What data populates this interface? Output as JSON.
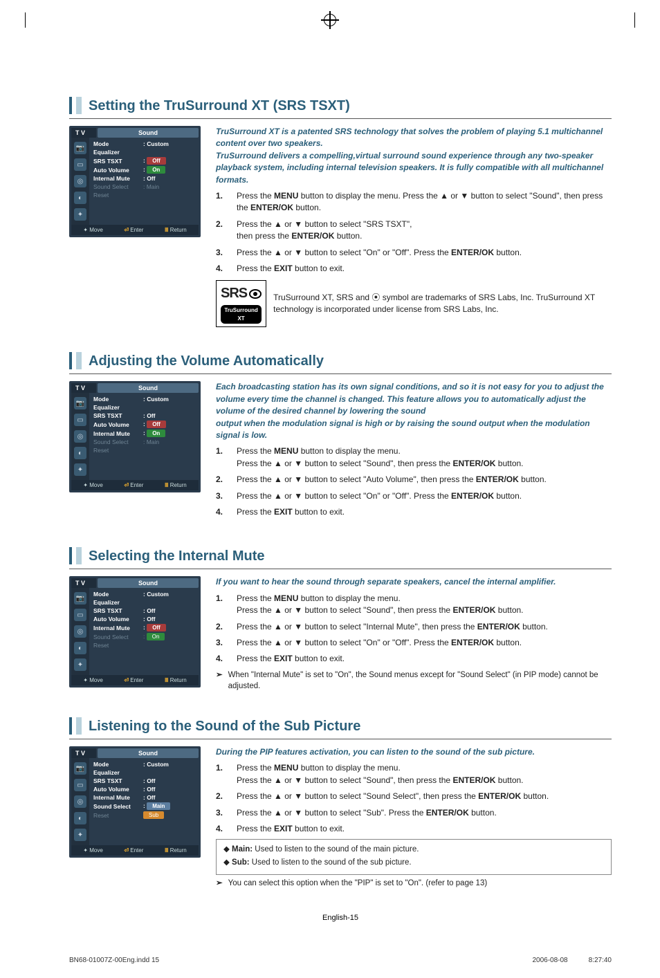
{
  "osd_common": {
    "tv": "T V",
    "title": "Sound",
    "nav": {
      "move": "Move",
      "enter": "Enter",
      "return": "Return"
    }
  },
  "sections": [
    {
      "heading": "Setting the TruSurround XT (SRS TSXT)",
      "intro": "TruSurround XT is a patented SRS technology that solves the problem of playing 5.1 multichannel content over two speakers.\nTruSurround delivers a compelling,virtual surround sound experience through any two-speaker playback system, including internal television speakers. It is fully compatible with all multichannel formats.",
      "steps": [
        "Press the <b>MENU</b> button to display the menu. Press the ▲ or ▼ button to select \"Sound\", then press the <b>ENTER/OK</b> button.",
        "Press the ▲ or ▼ button to select \"SRS TSXT\",<br>then press the <b>ENTER/OK</b> button.",
        "Press the ▲ or ▼ button to select \"On\" or \"Off\". Press the <b>ENTER/OK</b> button.",
        "Press the <b>EXIT</b> button to exit."
      ],
      "srs_note": "TruSurround XT, SRS and ⦿ symbol are trademarks of SRS Labs, Inc. TruSurround XT technology is incorporated under license from SRS Labs, Inc.",
      "srs_logo": {
        "brand": "SRS",
        "tag": "TruSurround XT"
      },
      "osd_rows": [
        {
          "lbl": "Mode",
          "val": ": Custom",
          "cls": "hl"
        },
        {
          "lbl": "Equalizer",
          "val": "",
          "cls": "hl"
        },
        {
          "lbl": "SRS TSXT",
          "val": ":",
          "cls": "hl",
          "pill": "off",
          "pill_txt": "Off"
        },
        {
          "lbl": "Auto Volume",
          "val": ":",
          "cls": "hl",
          "pill": "on",
          "pill_txt": "On"
        },
        {
          "lbl": "Internal Mute",
          "val": ": Off",
          "cls": "hl"
        },
        {
          "lbl": "Sound Select",
          "val": ": Main",
          "cls": "dim"
        },
        {
          "lbl": "Reset",
          "val": "",
          "cls": "dim"
        }
      ]
    },
    {
      "heading": "Adjusting the Volume Automatically",
      "intro": "Each broadcasting station has its own signal conditions, and so it is not easy for you to adjust the volume every time the channel is changed. This feature allows you to automatically adjust the volume of the desired channel by lowering the sound\noutput when the modulation signal is high or by raising the sound output when the modulation signal is low.",
      "steps": [
        "Press the <b>MENU</b> button to display the menu.<br>Press the ▲ or ▼ button to select \"Sound\", then press the <b>ENTER/OK</b> button.",
        "Press the ▲ or ▼ button to select \"Auto Volume\", then press the <b>ENTER/OK</b> button.",
        "Press the ▲ or ▼ button to select \"On\" or \"Off\". Press the <b>ENTER/OK</b> button.",
        "Press the <b>EXIT</b> button to exit."
      ],
      "osd_rows": [
        {
          "lbl": "Mode",
          "val": ": Custom",
          "cls": "hl"
        },
        {
          "lbl": "Equalizer",
          "val": "",
          "cls": "hl"
        },
        {
          "lbl": "SRS TSXT",
          "val": ": Off",
          "cls": "hl"
        },
        {
          "lbl": "Auto Volume",
          "val": ":",
          "cls": "hl",
          "pill": "off",
          "pill_txt": "Off"
        },
        {
          "lbl": "Internal Mute",
          "val": ":",
          "cls": "hl",
          "pill": "on",
          "pill_txt": "On"
        },
        {
          "lbl": "Sound Select",
          "val": ": Main",
          "cls": "dim"
        },
        {
          "lbl": "Reset",
          "val": "",
          "cls": "dim"
        }
      ]
    },
    {
      "heading": "Selecting the Internal Mute",
      "intro": "If you want to hear the sound through separate speakers, cancel the internal amplifier.",
      "steps": [
        "Press the <b>MENU</b> button to display the menu.<br>Press the ▲ or ▼ button to select \"Sound\", then press the <b>ENTER/OK</b> button.",
        "Press the ▲ or ▼ button to select \"Internal Mute\", then press the <b>ENTER/OK</b> button.",
        "Press the ▲ or ▼ button to select \"On\" or \"Off\". Press the <b>ENTER/OK</b> button.",
        "Press the <b>EXIT</b> button to exit."
      ],
      "note": "When \"Internal Mute\" is set to \"On\", the Sound menus except for \"Sound Select\" (in PIP mode) cannot be adjusted.",
      "osd_rows": [
        {
          "lbl": "Mode",
          "val": ": Custom",
          "cls": "hl"
        },
        {
          "lbl": "Equalizer",
          "val": "",
          "cls": "hl"
        },
        {
          "lbl": "SRS TSXT",
          "val": ": Off",
          "cls": "hl"
        },
        {
          "lbl": "Auto Volume",
          "val": ": Off",
          "cls": "hl"
        },
        {
          "lbl": "Internal Mute",
          "val": ":",
          "cls": "hl",
          "pill": "off",
          "pill_txt": "Off"
        },
        {
          "lbl": "Sound Select",
          "val": ":",
          "cls": "dim",
          "pill": "on",
          "pill_txt": "On"
        },
        {
          "lbl": "Reset",
          "val": "",
          "cls": "dim"
        }
      ]
    },
    {
      "heading": "Listening to the Sound of the Sub Picture",
      "intro": "During the PIP features activation, you can listen to the sound of the sub picture.",
      "steps": [
        "Press the <b>MENU</b> button to display the menu.<br>Press the ▲ or ▼ button to select \"Sound\", then press the <b>ENTER/OK</b> button.",
        "Press the ▲ or ▼ button to select \"Sound Select\", then press the <b>ENTER/OK</b> button.",
        "Press the ▲ or ▼ button to select \"Sub\". Press the <b>ENTER/OK</b> button.",
        "Press the <b>EXIT</b> button to exit."
      ],
      "info": [
        "<b>Main:</b> Used to listen to the sound of the main picture.",
        "<b>Sub:</b> Used to listen to the sound of the sub picture."
      ],
      "note": "You can select this option when the \"PIP\" is set to \"On\". (refer to page 13)",
      "osd_rows": [
        {
          "lbl": "Mode",
          "val": ": Custom",
          "cls": "hl"
        },
        {
          "lbl": "Equalizer",
          "val": "",
          "cls": "hl"
        },
        {
          "lbl": "SRS TSXT",
          "val": ": Off",
          "cls": "hl"
        },
        {
          "lbl": "Auto Volume",
          "val": ": Off",
          "cls": "hl"
        },
        {
          "lbl": "Internal Mute",
          "val": ": Off",
          "cls": "hl"
        },
        {
          "lbl": "Sound Select",
          "val": ":",
          "cls": "hl",
          "pill": "main",
          "pill_txt": "Main"
        },
        {
          "lbl": "Reset",
          "val": "",
          "cls": "dim",
          "pill": "sub",
          "pill_txt": "Sub"
        }
      ]
    }
  ],
  "page_num": "English-15",
  "printfoot": {
    "file": "BN68-01007Z-00Eng.indd   15",
    "date": "2006-08-08",
    "time": "8:27:40"
  }
}
